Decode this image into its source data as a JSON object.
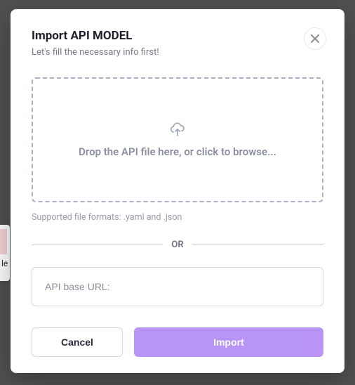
{
  "modal": {
    "title": "Import API MODEL",
    "subtitle": "Let's fill the necessary info first!"
  },
  "dropzone": {
    "text": "Drop the API file here, or click to browse..."
  },
  "supported_text": "Supported file formats: .yaml and .json",
  "divider": {
    "label": "OR"
  },
  "url_input": {
    "placeholder": "API base URL:",
    "value": ""
  },
  "buttons": {
    "cancel": "Cancel",
    "import": "Import"
  },
  "bg_fragment": {
    "text": "le"
  },
  "colors": {
    "accent": "#b794f6",
    "border_dashed": "#a9b0c2",
    "text_muted": "#8a8fa0"
  }
}
